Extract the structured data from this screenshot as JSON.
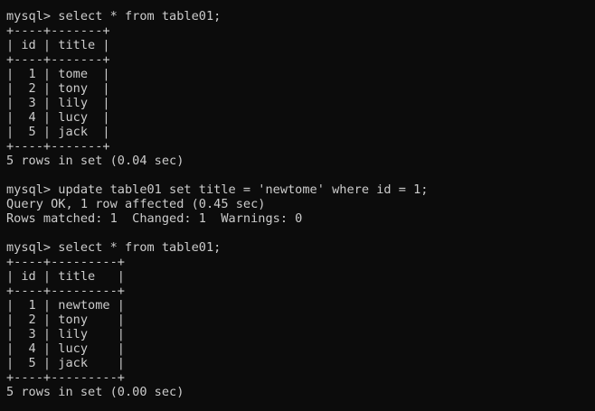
{
  "terminal": {
    "lines": [
      "mysql> select * from table01;",
      "+----+-------+",
      "| id | title |",
      "+----+-------+",
      "|  1 | tome  |",
      "|  2 | tony  |",
      "|  3 | lily  |",
      "|  4 | lucy  |",
      "|  5 | jack  |",
      "+----+-------+",
      "5 rows in set (0.04 sec)",
      "",
      "mysql> update table01 set title = 'newtome' where id = 1;",
      "Query OK, 1 row affected (0.45 sec)",
      "Rows matched: 1  Changed: 1  Warnings: 0",
      "",
      "mysql> select * from table01;",
      "+----+---------+",
      "| id | title   |",
      "+----+---------+",
      "|  1 | newtome |",
      "|  2 | tony    |",
      "|  3 | lily    |",
      "|  4 | lucy    |",
      "|  5 | jack    |",
      "+----+---------+",
      "5 rows in set (0.00 sec)"
    ]
  }
}
